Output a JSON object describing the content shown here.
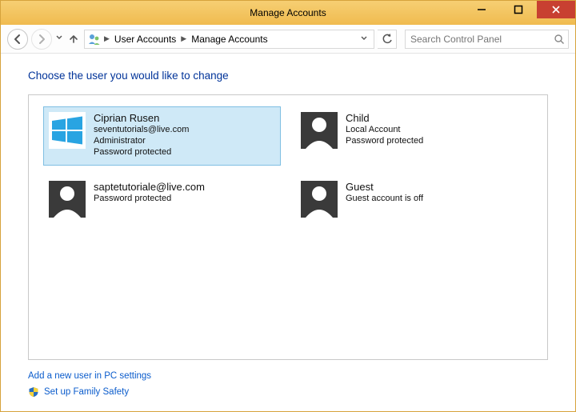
{
  "window": {
    "title": "Manage Accounts"
  },
  "breadcrumb": {
    "root_icon": "user-accounts-icon",
    "item1": "User Accounts",
    "item2": "Manage Accounts"
  },
  "search": {
    "placeholder": "Search Control Panel"
  },
  "heading": "Choose the user you would like to change",
  "accounts": [
    {
      "name": "Ciprian Rusen",
      "line2": "seventutorials@live.com",
      "line3": "Administrator",
      "line4": "Password protected",
      "avatar": "winlogo",
      "selected": true
    },
    {
      "name": "Child",
      "line2": "Local Account",
      "line3": "Password protected",
      "line4": "",
      "avatar": "person",
      "selected": false
    },
    {
      "name": "saptetutoriale@live.com",
      "line2": "Password protected",
      "line3": "",
      "line4": "",
      "avatar": "person",
      "selected": false
    },
    {
      "name": "Guest",
      "line2": "Guest account is off",
      "line3": "",
      "line4": "",
      "avatar": "person",
      "selected": false
    }
  ],
  "links": {
    "add_user": "Add a new user in PC settings",
    "family_safety": "Set up Family Safety"
  }
}
